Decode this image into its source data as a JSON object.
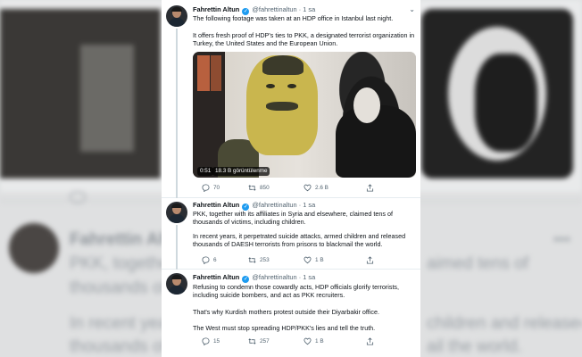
{
  "background": {
    "author_name": "Fahrettin Altu",
    "line1": "PKK, together",
    "line2": "thousands of v",
    "line3": "In recent years",
    "line4": "thousands of D",
    "right1": "aimed tens of",
    "right2": "",
    "right3": "children and released",
    "right4": "ail the world."
  },
  "tweets": [
    {
      "author": "Fahrettin Altun",
      "handle": "@fahrettinaltun",
      "separator": "·",
      "time": "1 sa",
      "text": [
        "The following footage was taken at an HDP office in Istanbul last night.",
        "It offers fresh proof of HDP's ties to PKK, a designated terrorist organization in Turkey, the United States and the European Union."
      ],
      "video": {
        "duration": "0:51",
        "views": "18.3 B görüntülenme"
      },
      "replies": "70",
      "retweets": "850",
      "likes": "2.6 B"
    },
    {
      "author": "Fahrettin Altun",
      "handle": "@fahrettinaltun",
      "separator": "·",
      "time": "1 sa",
      "text": [
        "PKK, together with its affiliates in Syria and elsewhere, claimed tens of thousands of victims, including children.",
        "In recent years, it perpetrated suicide attacks, armed children and released thousands of DAESH terrorists from prisons to blackmail the world."
      ],
      "replies": "6",
      "retweets": "253",
      "likes": "1 B"
    },
    {
      "author": "Fahrettin Altun",
      "handle": "@fahrettinaltun",
      "separator": "·",
      "time": "1 sa",
      "text": [
        "Refusing to condemn those cowardly acts, HDP officials glorify terrorists, including suicide bombers, and act as PKK recruiters.",
        "That's why Kurdish mothers protest outside their Diyarbakir office.",
        "The West must stop spreading HDP/PKK's lies and tell the truth."
      ],
      "replies": "15",
      "retweets": "257",
      "likes": "1 B"
    }
  ],
  "icons": {
    "reply": "reply-icon",
    "retweet": "retweet-icon",
    "like": "heart-icon",
    "share": "share-icon",
    "verified": "verified-badge-icon",
    "more": "more-caret-icon"
  },
  "colors": {
    "verified": "#1d9bf0",
    "text": "#0f1419",
    "muted": "#536471"
  }
}
